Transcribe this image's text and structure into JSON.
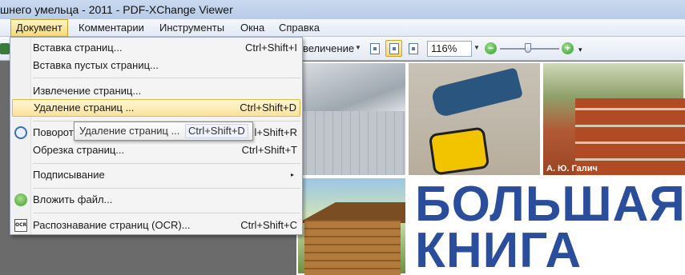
{
  "window": {
    "title": "шнего умельца - 2011 - PDF-XChange Viewer"
  },
  "menubar": {
    "items": [
      {
        "label": "Документ",
        "active": true
      },
      {
        "label": "Комментарии"
      },
      {
        "label": "Инструменты"
      },
      {
        "label": "Окна"
      },
      {
        "label": "Справка"
      }
    ]
  },
  "toolbar": {
    "zoom_mode_label": "величение",
    "zoom_value": "116%",
    "zoom_slider_fraction": 0.45,
    "icons": [
      "fit-width-icon",
      "fit-page-icon",
      "actual-size-icon",
      "zoom-out-icon",
      "zoom-in-icon"
    ]
  },
  "document_menu": {
    "items": [
      {
        "label": "Вставка страниц...",
        "shortcut": "Ctrl+Shift+I"
      },
      {
        "label": "Вставка пустых страниц...",
        "shortcut": ""
      },
      {
        "label": "Извлечение страниц...",
        "shortcut": ""
      },
      {
        "label": "Удаление страниц ...",
        "shortcut": "Ctrl+Shift+D",
        "highlighted": true
      },
      {
        "label": "Поворот",
        "shortcut": "l+Shift+R",
        "icon": "rotate-icon"
      },
      {
        "label": "Обрезка страниц...",
        "shortcut": "Ctrl+Shift+T"
      },
      {
        "label": "Подписывание",
        "shortcut": "",
        "submenu": true
      },
      {
        "label": "Вложить файл...",
        "shortcut": "",
        "icon": "attach-icon"
      },
      {
        "label": "Распознавание страниц (OCR)...",
        "shortcut": "Ctrl+Shift+C",
        "icon": "ocr-icon",
        "icon_text": "OCR"
      }
    ]
  },
  "tooltip": {
    "label": "Удаление страниц ...",
    "shortcut": "Ctrl+Shift+D"
  },
  "page": {
    "author": "А. Ю. Галич",
    "title_line1": "БОЛЬШАЯ",
    "title_line2": "КНИГА"
  },
  "colors": {
    "accent_highlight": "#fbe39b",
    "book_title": "#2a4d9c"
  }
}
